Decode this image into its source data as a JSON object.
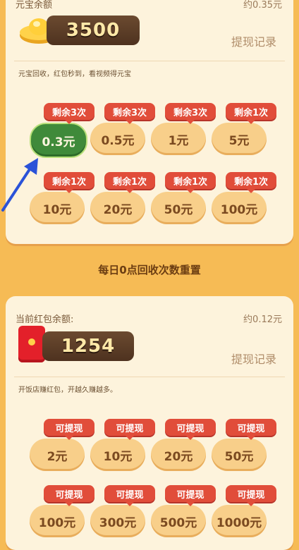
{
  "yuanbao": {
    "title": "元宝余额",
    "approx": "约0.35元",
    "balance": "3500",
    "record_link": "提现记录",
    "info": "元宝回收，红包秒到，看视频得元宝",
    "options": [
      {
        "badge": "剩余3次",
        "amount": "0.3元",
        "selected": true
      },
      {
        "badge": "剩余3次",
        "amount": "0.5元"
      },
      {
        "badge": "剩余3次",
        "amount": "1元"
      },
      {
        "badge": "剩余1次",
        "amount": "5元"
      },
      {
        "badge": "剩余1次",
        "amount": "10元"
      },
      {
        "badge": "剩余1次",
        "amount": "20元"
      },
      {
        "badge": "剩余1次",
        "amount": "50元"
      },
      {
        "badge": "剩余1次",
        "amount": "100元"
      }
    ]
  },
  "reset_notice": "每日0点回收次数重置",
  "redpacket": {
    "title": "当前红包余额:",
    "approx": "约0.12元",
    "balance": "1254",
    "record_link": "提现记录",
    "info": "开饭店赚红包，开越久赚越多。",
    "options": [
      {
        "badge": "可提现",
        "amount": "2元"
      },
      {
        "badge": "可提现",
        "amount": "10元"
      },
      {
        "badge": "可提现",
        "amount": "20元"
      },
      {
        "badge": "可提现",
        "amount": "50元"
      },
      {
        "badge": "可提现",
        "amount": "100元"
      },
      {
        "badge": "可提现",
        "amount": "300元"
      },
      {
        "badge": "可提现",
        "amount": "500元"
      },
      {
        "badge": "可提现",
        "amount": "1000元"
      }
    ]
  },
  "colors": {
    "background": "#f6bb55",
    "badge": "#e14d3a",
    "selected": "#3f8a3a",
    "arrow": "#2a52d8"
  }
}
